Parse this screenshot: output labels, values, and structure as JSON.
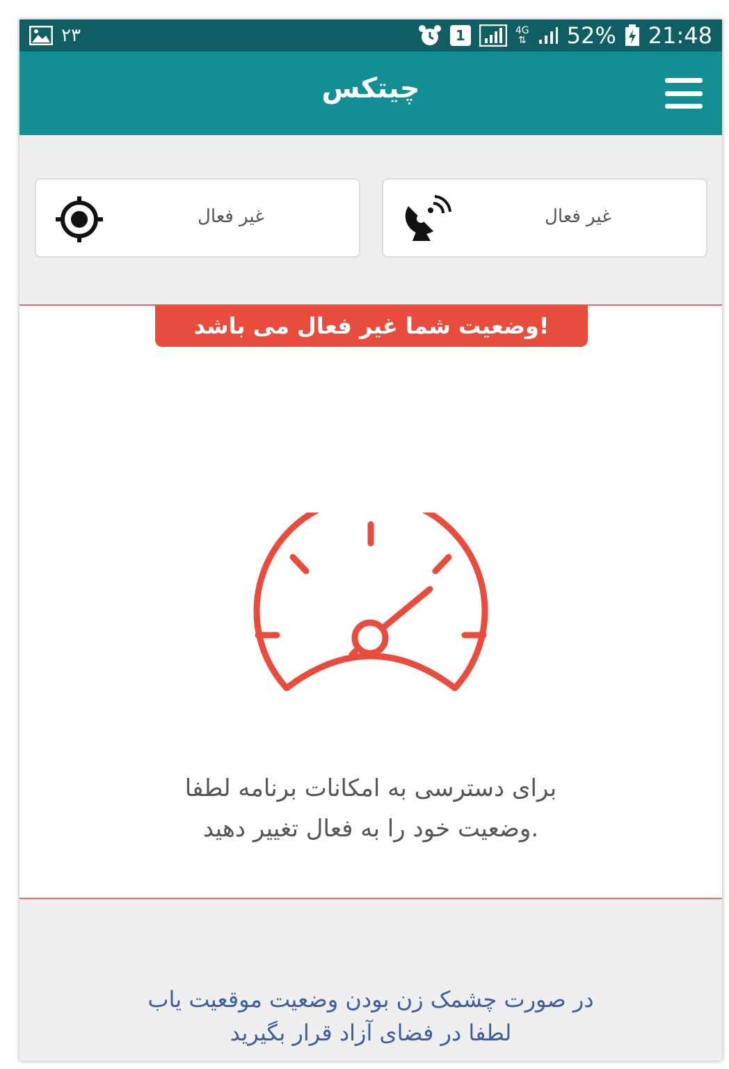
{
  "status_bar": {
    "left_number": "۲۳",
    "battery_percent": "52%",
    "clock": "21:48",
    "sim_badge": "1",
    "network_badge": "4G"
  },
  "app_bar": {
    "title": "چیتکس"
  },
  "status_cards": {
    "gps": {
      "label": "غیر فعال",
      "icon": "gps-target-icon"
    },
    "connection": {
      "label": "غیر فعال",
      "icon": "satellite-dish-icon"
    }
  },
  "banner": {
    "text": "وضعیت شما غیر فعال می باشد!"
  },
  "gauge": {
    "icon": "speedometer-icon",
    "color": "#e74c3c"
  },
  "message": {
    "line1": "برای دسترسی به امکانات برنامه لطفا",
    "line2": "وضعیت خود را به فعال تغییر دهید."
  },
  "hint": {
    "line1": "در صورت چشمک زن بودن وضعیت موقعیت یاب",
    "line2": "لطفا در فضای آزاد قرار بگیرید"
  },
  "colors": {
    "status_bar": "#0e5e63",
    "app_bar": "#138e93",
    "accent_red": "#e74c3c",
    "hint_blue": "#3a5da3",
    "panel_grey": "#efefef"
  }
}
